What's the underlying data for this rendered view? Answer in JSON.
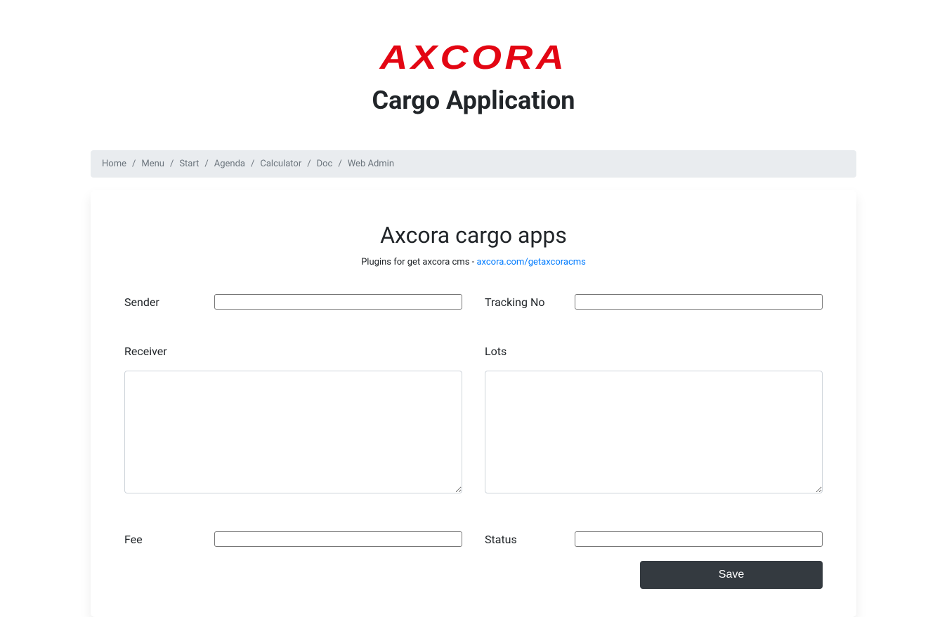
{
  "header": {
    "logo": "AXCORA",
    "title": "Cargo Application"
  },
  "breadcrumb": {
    "items": [
      {
        "label": "Home"
      },
      {
        "label": "Menu"
      },
      {
        "label": "Start"
      },
      {
        "label": "Agenda"
      },
      {
        "label": "Calculator"
      },
      {
        "label": "Doc"
      },
      {
        "label": "Web Admin"
      }
    ]
  },
  "card": {
    "title": "Axcora cargo apps",
    "subtitle_prefix": "Plugins for get axcora cms - ",
    "subtitle_link": "axcora.com/getaxcoracms"
  },
  "form": {
    "sender": {
      "label": "Sender",
      "value": ""
    },
    "tracking_no": {
      "label": "Tracking No",
      "value": ""
    },
    "receiver": {
      "label": "Receiver",
      "value": ""
    },
    "lots": {
      "label": "Lots",
      "value": ""
    },
    "fee": {
      "label": "Fee",
      "value": ""
    },
    "status": {
      "label": "Status",
      "value": ""
    },
    "save_label": "Save"
  }
}
